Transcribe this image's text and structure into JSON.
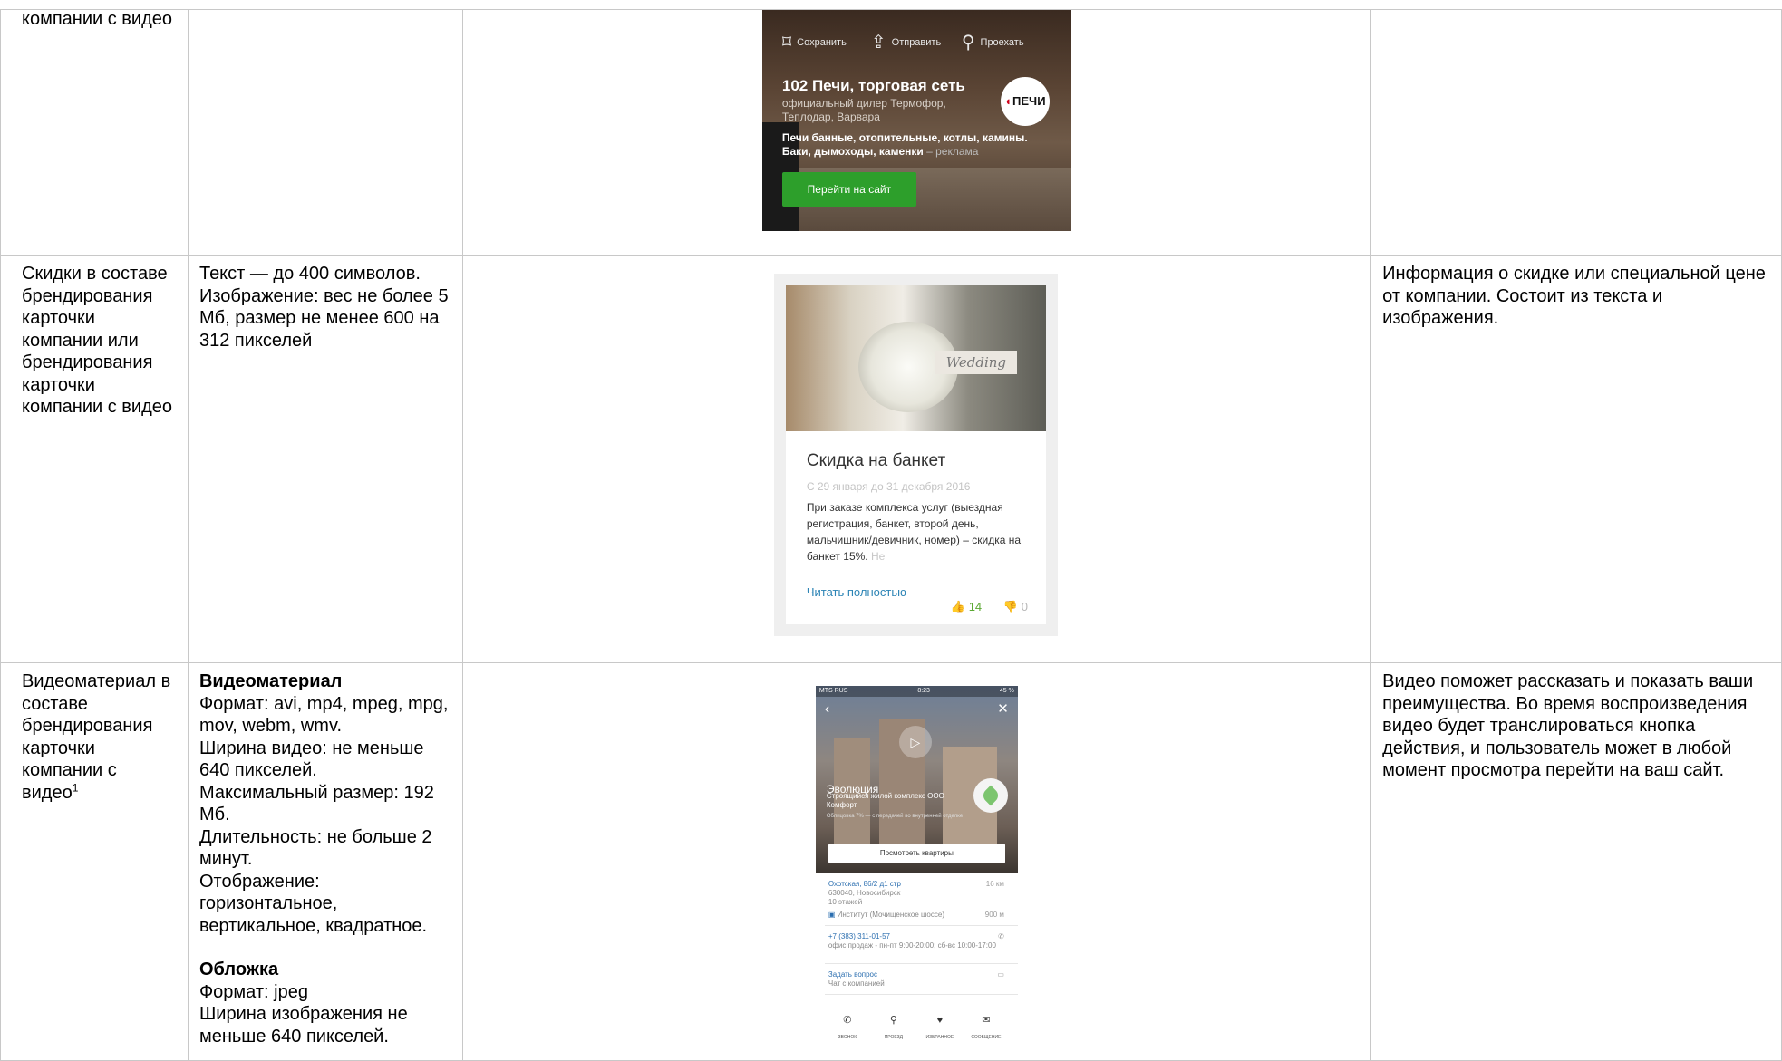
{
  "rows": [
    {
      "col1": "компании с видео",
      "col2": "",
      "col4": "",
      "banner": {
        "actions": [
          {
            "icon": "bookmark-icon",
            "glyph": "🔖",
            "label": "Сохранить"
          },
          {
            "icon": "share-icon",
            "glyph": "⇪",
            "label": "Отправить"
          },
          {
            "icon": "route-icon",
            "glyph": "⚲",
            "label": "Проехать"
          }
        ],
        "title": "102 Печи, торговая сеть",
        "subtitle": "официальный дилер Термофор, Теплодар, Варвара",
        "description": "Печи банные, отопительные, котлы, камины. Баки, дымоходы, каменки",
        "ad_label": "– реклама",
        "logo_text": "ПЕЧИ",
        "button": "Перейти на сайт"
      }
    },
    {
      "col1": "Скидки в составе брендирования карточки компании или брендирования карточки компании с видео",
      "col2": "Текст — до 400 символов. Изображение: вес не более 5 Мб, размер не менее 600 на 312 пикселей",
      "col4": "Информация о скидке или специальной цене от компании. Состоит из текста и изображения.",
      "discount": {
        "sign_text": "Wedding",
        "title": "Скидка на банкет",
        "dates": "С 29 января до 31 декабря 2016",
        "text": "При заказе комплекса услуг (выездная регистрация, банкет, второй день, мальчишник/девичник, номер) – скидка на банкет 15%.",
        "text_fade": "Не",
        "read_more": "Читать полностью",
        "likes": "14",
        "dislikes": "0"
      }
    },
    {
      "col1": "Видеоматериал в составе брендирования карточки компании с видео",
      "col1_sup": "1",
      "col2": {
        "video_heading": "Видеоматериал",
        "video_lines": [
          "Формат: avi, mp4, mpeg, mpg, mov, webm, wmv.",
          "Ширина видео: не меньше 640 пикселей.",
          "Максимальный размер: 192 Мб.",
          "Длительность: не больше 2 минут.",
          "Отображение: горизонтальное, вертикальное, квадратное."
        ],
        "cover_heading": "Обложка",
        "cover_lines": [
          "Формат: jpeg",
          "Ширина изображения не меньше 640 пикселей."
        ]
      },
      "col4": "Видео поможет рассказать и показать ваши преимущества. Во время воспроизведения видео будет транслироваться кнопка действия, и пользователь может в любой момент просмотра перейти на ваш сайт.",
      "phone": {
        "carrier": "MTS RUS",
        "time": "8:23",
        "battery": "45 %",
        "name": "Эволюция",
        "subtitle": "Строящийся жилой комплекс ООО Комфорт",
        "small_text": "Облицовка 7% — с передачей во внутренней отделке",
        "button": "Посмотреть квартиры",
        "address": "Охотская, 86/2 д1 стр",
        "address_extra": "630040, Новосибирск\n10 этажей",
        "distance": "16 км",
        "metro": "Институт (Мочищенское шоссе)",
        "metro_distance": "900 м",
        "phone_number": "+7 (383) 311-01-57",
        "hours": "офис продаж - пн-пт 9:00-20:00; сб-вс 10:00-17:00",
        "ask": "Задать вопрос",
        "chat": "Чат с компанией",
        "tabs": [
          {
            "icon": "phone-icon",
            "glyph": "✆",
            "label": "ЗВОНОК"
          },
          {
            "icon": "route-icon",
            "glyph": "⚲",
            "label": "ПРОЕЗД"
          },
          {
            "icon": "heart-icon",
            "glyph": "♥",
            "label": "ИЗБРАННОЕ"
          },
          {
            "icon": "message-icon",
            "glyph": "✉",
            "label": "СООБЩЕНИЕ"
          }
        ]
      }
    }
  ]
}
